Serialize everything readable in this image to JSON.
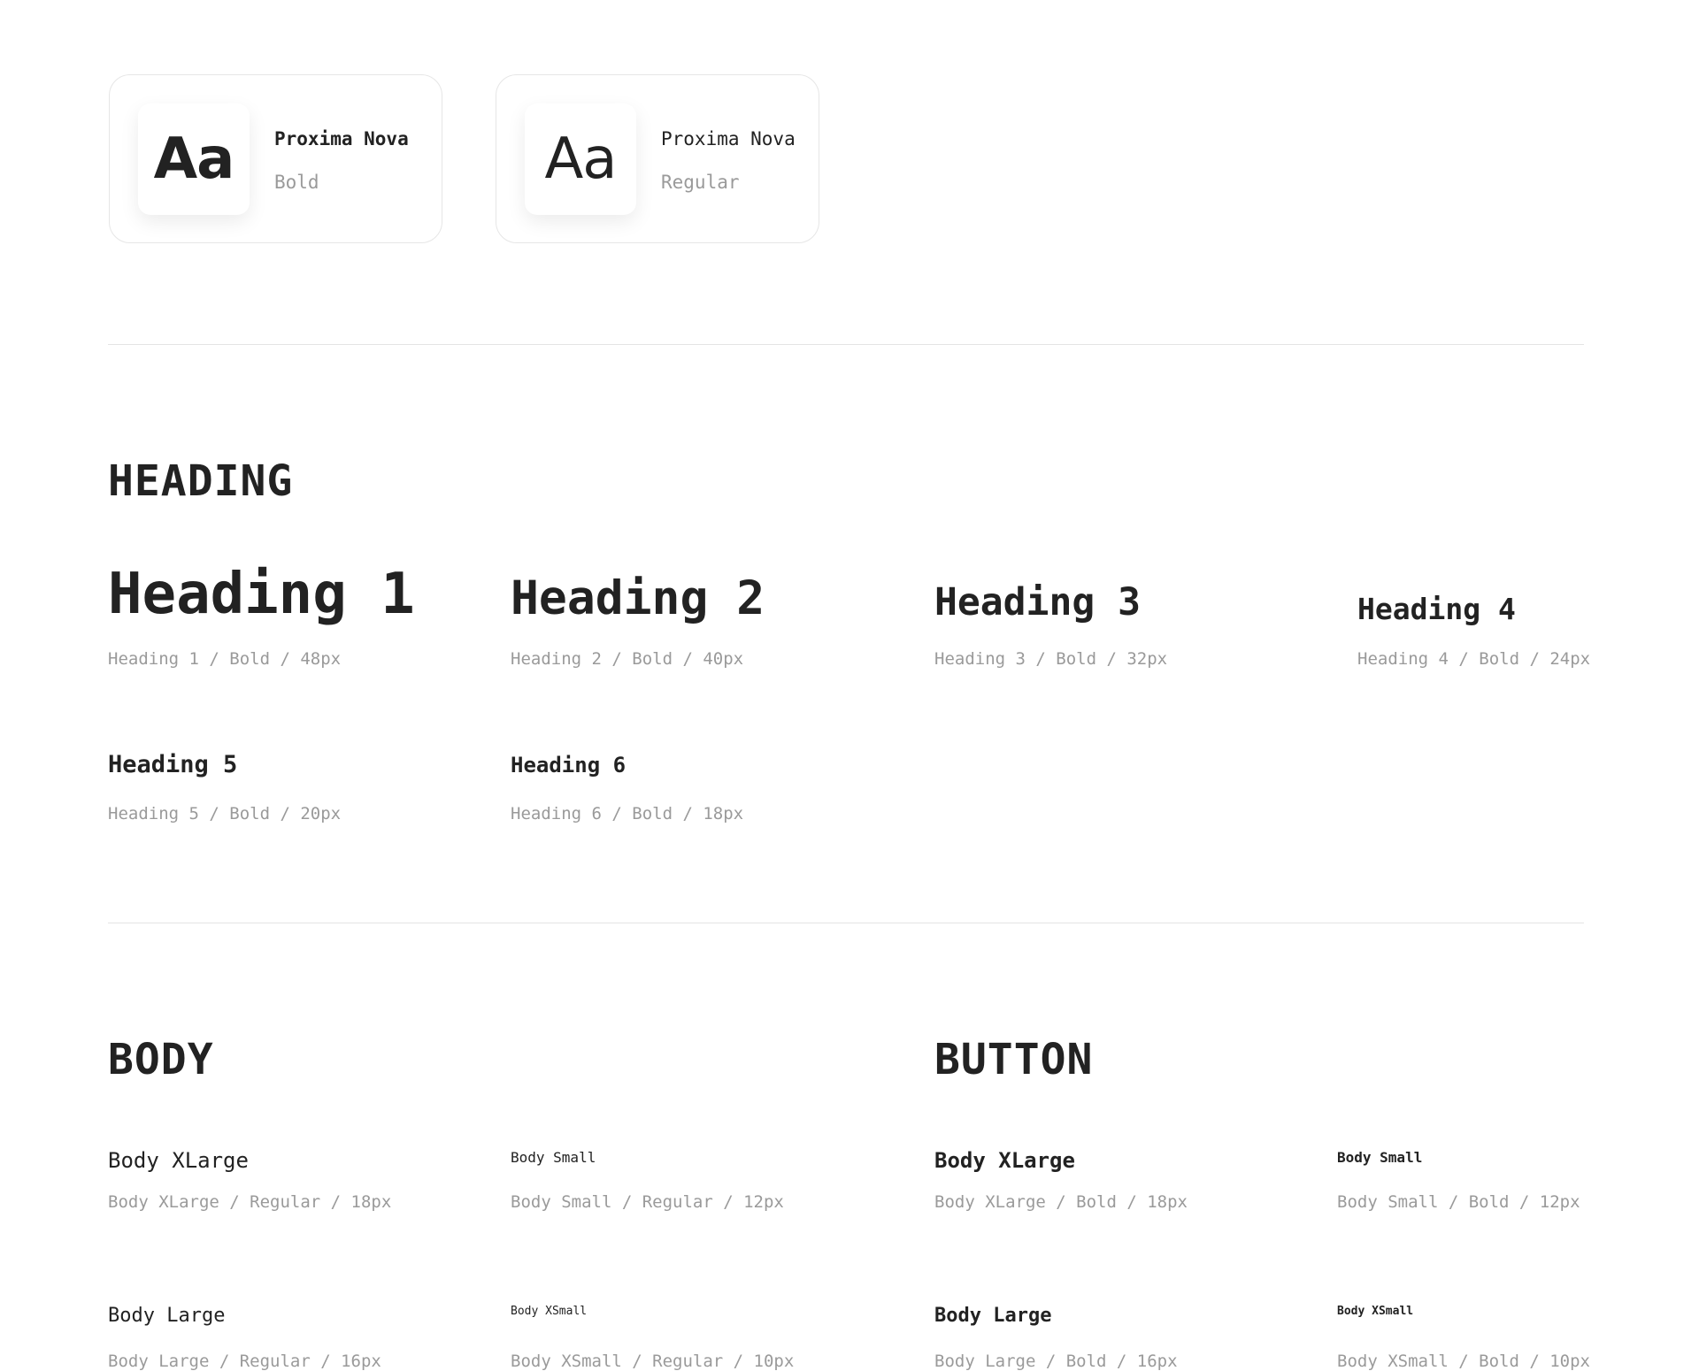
{
  "font_cards": [
    {
      "preview": "Aa",
      "family": "Proxima Nova",
      "weight": "Bold"
    },
    {
      "preview": "Aa",
      "family": "Proxima Nova",
      "weight": "Regular"
    }
  ],
  "heading_section": {
    "title": "HEADING",
    "items": [
      {
        "label": "Heading 1",
        "meta": "Heading 1 / Bold / 48px"
      },
      {
        "label": "Heading 2",
        "meta": "Heading 2 / Bold / 40px"
      },
      {
        "label": "Heading 3",
        "meta": "Heading 3 / Bold / 32px"
      },
      {
        "label": "Heading 4",
        "meta": "Heading 4 / Bold / 24px"
      },
      {
        "label": "Heading 5",
        "meta": "Heading 5 / Bold / 20px"
      },
      {
        "label": "Heading 6",
        "meta": "Heading 6 / Bold / 18px"
      }
    ]
  },
  "body_section": {
    "title": "BODY",
    "items": [
      {
        "label": "Body XLarge",
        "meta": "Body XLarge / Regular / 18px"
      },
      {
        "label": "Body Small",
        "meta": "Body Small / Regular / 12px"
      },
      {
        "label": "Body Large",
        "meta": "Body Large / Regular / 16px"
      },
      {
        "label": "Body XSmall",
        "meta": "Body XSmall / Regular / 10px"
      }
    ]
  },
  "button_section": {
    "title": "BUTTON",
    "items": [
      {
        "label": "Body XLarge",
        "meta": "Body XLarge / Bold / 18px"
      },
      {
        "label": "Body Small",
        "meta": "Body Small / Bold / 12px"
      },
      {
        "label": "Body Large",
        "meta": "Body Large / Bold / 16px"
      },
      {
        "label": "Body XSmall",
        "meta": "Body XSmall / Bold / 10px"
      }
    ]
  }
}
